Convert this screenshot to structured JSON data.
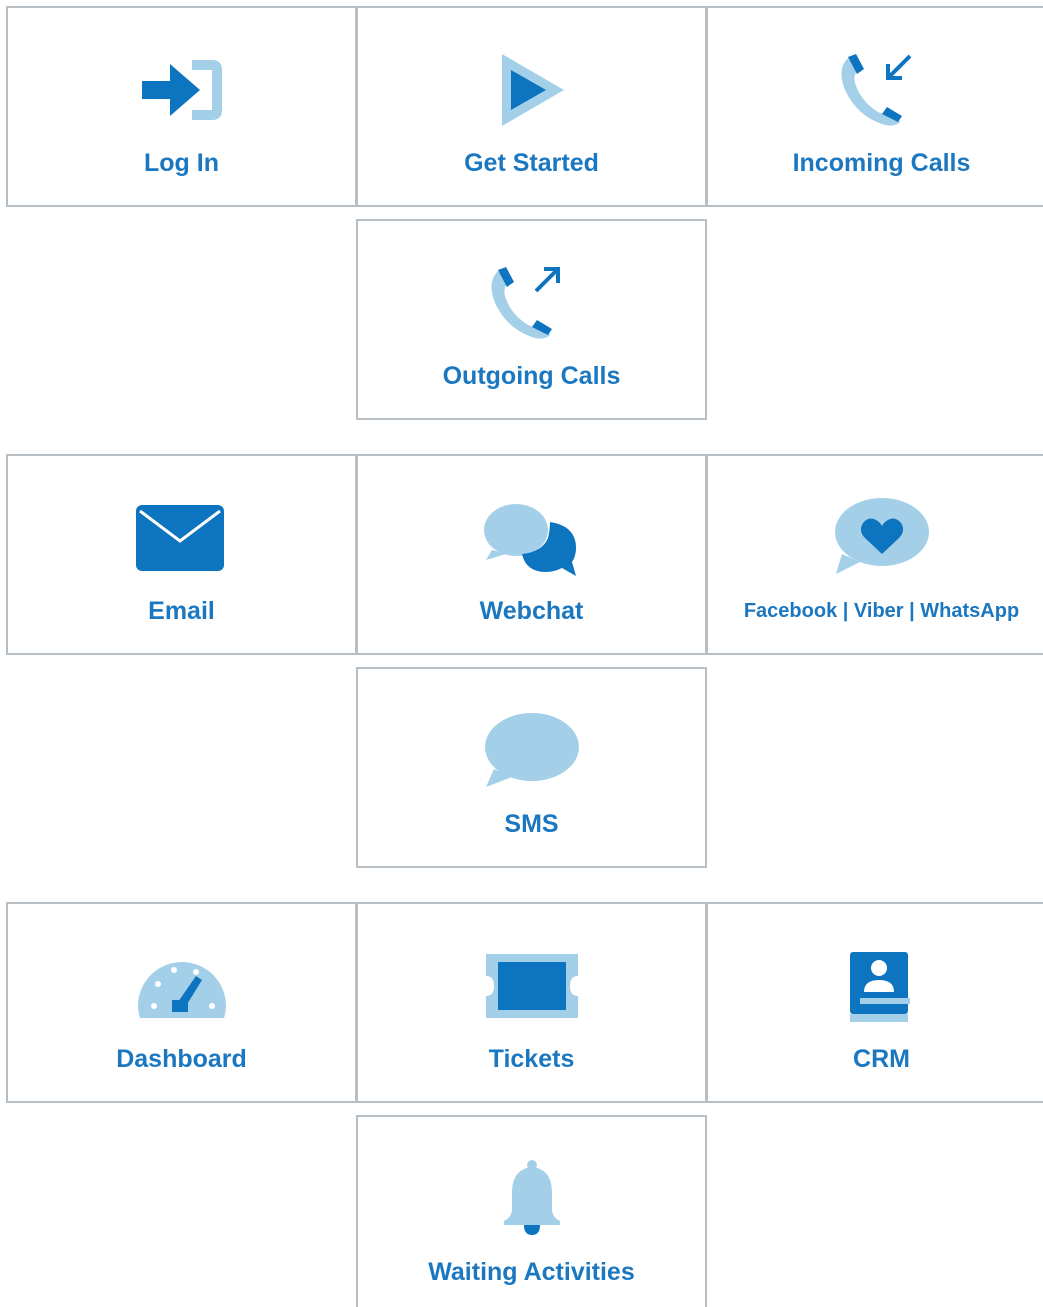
{
  "colors": {
    "primary": "#0d74bf",
    "light": "#a4cfe8",
    "border": "#b7bec4",
    "label": "#1b78c0"
  },
  "tiles": [
    {
      "label": "Log In",
      "icon": "login-icon"
    },
    {
      "label": "Get Started",
      "icon": "play-icon"
    },
    {
      "label": "Incoming Calls",
      "icon": "incoming-call-icon"
    },
    {
      "label": "Outgoing Calls",
      "icon": "outgoing-call-icon"
    },
    {
      "label": "Email",
      "icon": "envelope-icon"
    },
    {
      "label": "Webchat",
      "icon": "chat-bubbles-icon"
    },
    {
      "label": "Facebook | Viber | WhatsApp",
      "icon": "heart-bubble-icon"
    },
    {
      "label": "SMS",
      "icon": "speech-bubble-icon"
    },
    {
      "label": "Dashboard",
      "icon": "speedometer-icon"
    },
    {
      "label": "Tickets",
      "icon": "ticket-icon"
    },
    {
      "label": "CRM",
      "icon": "contact-book-icon"
    },
    {
      "label": "Waiting Activities",
      "icon": "bell-icon"
    }
  ]
}
